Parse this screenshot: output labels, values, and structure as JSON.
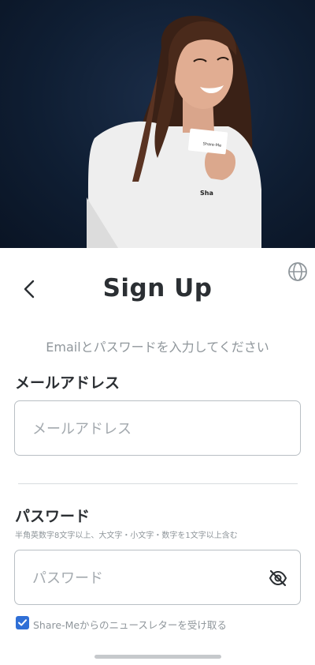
{
  "hero": {
    "card_text": "Share-Me",
    "shirt_text": "Sha"
  },
  "header": {
    "title": "Sign Up"
  },
  "intro": {
    "subtitle": "Emailとパスワードを入力してください"
  },
  "email": {
    "label": "メールアドレス",
    "placeholder": "メールアドレス"
  },
  "password": {
    "label": "パスワード",
    "hint": "半角英数字8文字以上、大文字・小文字・数字を1文字以上含む",
    "placeholder": "パスワード"
  },
  "newsletter": {
    "label": "Share-Meからのニュースレターを受け取る",
    "checked": true
  },
  "icons": {
    "back": "chevron-left-icon",
    "language": "globe-icon",
    "visibility": "eye-off-icon",
    "check": "checkmark-icon"
  },
  "colors": {
    "accent": "#2f6fd6",
    "text": "#2b2f33",
    "muted": "#8f969b",
    "hero_bg": "#0f1e33"
  }
}
